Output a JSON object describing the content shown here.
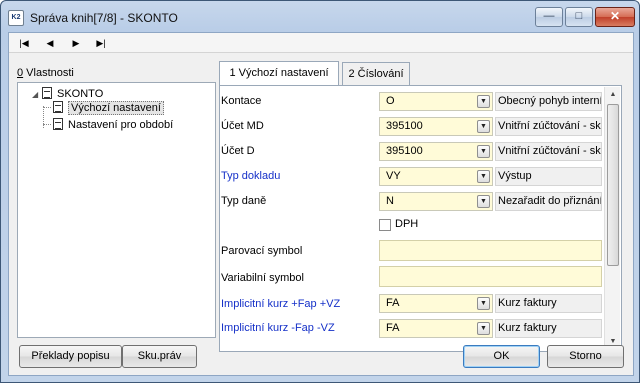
{
  "window": {
    "title": "Správa knih[7/8] - SKONTO",
    "app_icon_text": "K2",
    "minimize_glyph": "—",
    "maximize_glyph": "□",
    "close_glyph": "✕"
  },
  "navigation": {
    "first": "|◀",
    "prev": "◀",
    "next": "▶",
    "last": "▶|"
  },
  "tree": {
    "label_key": "0",
    "label_rest": " Vlastnosti",
    "root": {
      "expander": "◢",
      "label": "SKONTO"
    },
    "children": [
      {
        "label": "Výchozí nastavení",
        "selected": true
      },
      {
        "label": "Nastavení pro období",
        "selected": false
      }
    ]
  },
  "tabs": [
    {
      "label": "1 Výchozí nastavení",
      "active": true
    },
    {
      "label": "2 Číslování",
      "active": false
    }
  ],
  "form": {
    "rows": [
      {
        "label": "Kontace",
        "value": "O",
        "description": "Obecný pohyb interní",
        "blue": false
      },
      {
        "label": "Účet MD",
        "value": "395100",
        "description": "Vnitřní zúčtování - skc",
        "blue": false
      },
      {
        "label": "Účet D",
        "value": "395100",
        "description": "Vnitřní zúčtování - skc",
        "blue": false
      },
      {
        "label": "Typ dokladu",
        "value": "VY",
        "description": "Výstup",
        "blue": true
      },
      {
        "label": "Typ daně",
        "value": "N",
        "description": "Nezařadit do  přiznání",
        "blue": false
      }
    ],
    "dph": {
      "label": "DPH",
      "checked": false
    },
    "parovaci_symbol": {
      "label": "Parovací symbol",
      "value": ""
    },
    "variabilni_symbol": {
      "label": "Variabilní symbol",
      "value": ""
    },
    "kurz_rows": [
      {
        "label": "Implicitní kurz +Fap +VZ",
        "value": "FA",
        "description": "Kurz faktury",
        "blue": true
      },
      {
        "label": "Implicitní kurz -Fap -VZ",
        "value": "FA",
        "description": "Kurz faktury",
        "blue": true
      }
    ],
    "dropdown_glyph": "▼"
  },
  "scrollbar": {
    "up": "▲",
    "down": "▼"
  },
  "buttons": {
    "translate": "Překlady popisu",
    "sku": "Sku.práv",
    "ok": "OK",
    "cancel": "Storno"
  }
}
